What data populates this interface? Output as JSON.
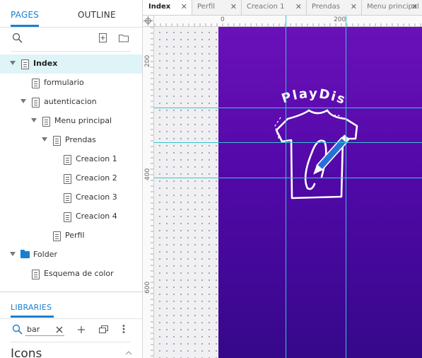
{
  "panel_tabs": {
    "pages": "PAGES",
    "outline": "OUTLINE"
  },
  "pages_toolbar": {
    "search_icon": "search-icon",
    "add_page_icon": "add-page-icon",
    "add_folder_icon": "add-folder-icon"
  },
  "pages": [
    {
      "label": "Index",
      "level": 0,
      "kind": "page",
      "expanded": true,
      "selected": true
    },
    {
      "label": "formulario",
      "level": 1,
      "kind": "page"
    },
    {
      "label": "autenticacion",
      "level": 1,
      "kind": "page",
      "expanded": true
    },
    {
      "label": "Menu principal",
      "level": 2,
      "kind": "page",
      "expanded": true
    },
    {
      "label": "Prendas",
      "level": 3,
      "kind": "page",
      "expanded": true
    },
    {
      "label": "Creacion 1",
      "level": 4,
      "kind": "page"
    },
    {
      "label": "Creacion 2",
      "level": 4,
      "kind": "page"
    },
    {
      "label": "Creacion 3",
      "level": 4,
      "kind": "page"
    },
    {
      "label": "Creacion 4",
      "level": 4,
      "kind": "page"
    },
    {
      "label": "Perfil",
      "level": 3,
      "kind": "page"
    },
    {
      "label": "Folder",
      "level": 0,
      "kind": "folder",
      "expanded": true
    },
    {
      "label": "Esquema de color",
      "level": 1,
      "kind": "page"
    }
  ],
  "libraries": {
    "title": "LIBRARIES",
    "search_value": "bar",
    "section_title": "Icons"
  },
  "doc_tabs": [
    {
      "label": "Index",
      "active": true
    },
    {
      "label": "Perfil"
    },
    {
      "label": "Creacion 1"
    },
    {
      "label": "Prendas"
    },
    {
      "label": "Menu principal"
    }
  ],
  "ruler": {
    "h_labels": [
      "0",
      "200"
    ],
    "v_labels": [
      "200",
      "400",
      "600"
    ]
  },
  "artboard": {
    "logo_text": "PlayDis",
    "colors": {
      "top": "#6a11b9",
      "bottom": "#36088a",
      "guide": "#38c4d6",
      "accent": "#1a7fcf"
    }
  }
}
